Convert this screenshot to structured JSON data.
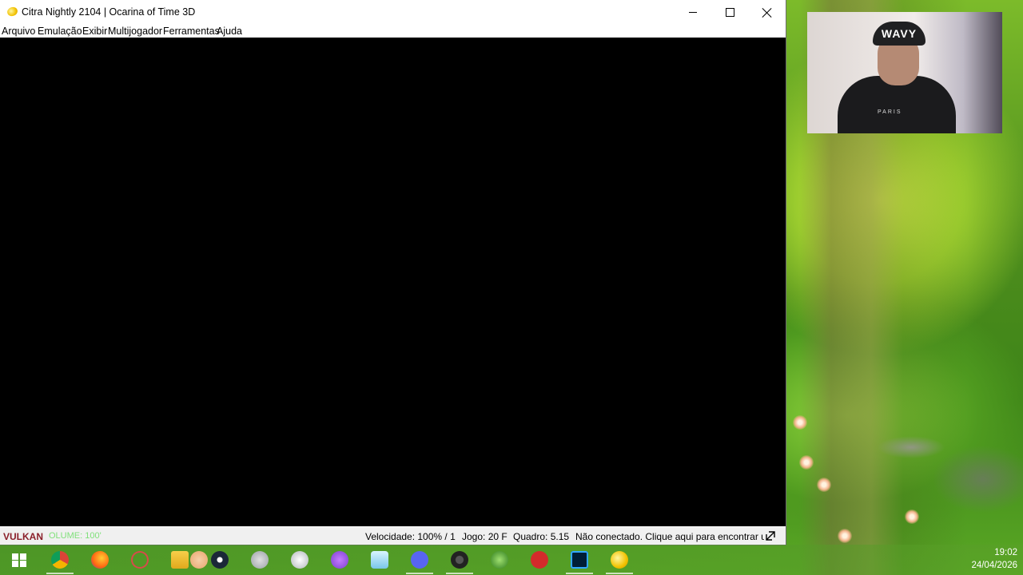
{
  "window": {
    "title": "Citra Nightly 2104 | Ocarina of Time 3D",
    "menu": [
      "Arquivo",
      "Emulação",
      "Exibir",
      "Multijogador",
      "Ferramentas",
      "Ajuda"
    ]
  },
  "status": {
    "api": "VULKAN",
    "volume": "OLUME: 100'",
    "speed": "Velocidade: 100% / 1",
    "game_fps": "Jogo: 20 F",
    "frame": "Quadro: 5.15",
    "network": "Não conectado. Clique aqui para encontrar u"
  },
  "webcam": {
    "cap_text": "WAVY",
    "shirt_text": "PARIS"
  },
  "taskbar": {
    "icons": [
      "windows-start-icon",
      "chrome-icon",
      "firefox-icon",
      "crosshair-app-icon",
      "file-explorer-icon",
      "flower-app-icon",
      "steam-icon",
      "paint-icon",
      "gamepad-icon",
      "controller-icon",
      "notepad-icon",
      "discord-icon",
      "obs-icon",
      "recycle-icon",
      "riot-icon",
      "photoshop-icon",
      "citra-icon"
    ]
  },
  "clock": {
    "time": "19:02",
    "date": "24/04/2026"
  }
}
